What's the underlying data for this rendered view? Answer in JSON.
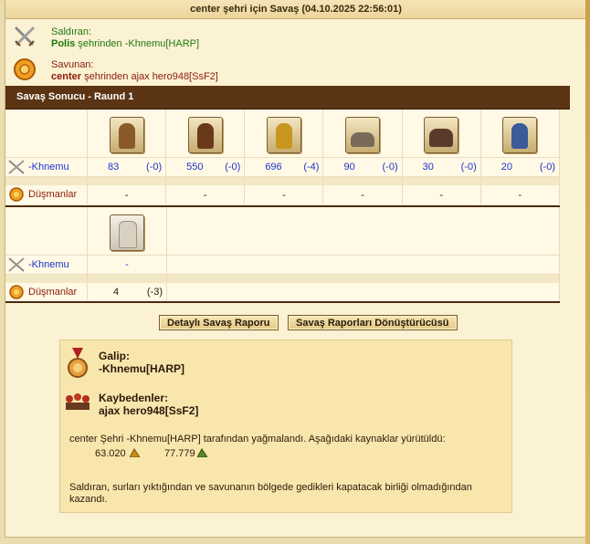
{
  "window": {
    "title": "center şehri için Savaş (04.10.2025 22:56:01)"
  },
  "attacker": {
    "label": "Saldıran:",
    "city": "Polis",
    "from_text": " şehrinden -Khnemu[HARP]",
    "icon": "crossed-swords-icon"
  },
  "defender": {
    "label": "Savunan:",
    "city": "center",
    "from_text": " şehrinden ajax hero948[SsF2]",
    "icon": "shield-icon"
  },
  "round": {
    "title": "Savaş Sonucu - Raund 1"
  },
  "section1": {
    "attacker_label": "-Khnemu",
    "enemy_label": "Düşmanlar",
    "units": [
      {
        "icon": "swordsman-icon",
        "count": "83",
        "change": "(-0)",
        "enemy": "-"
      },
      {
        "icon": "slinger-icon",
        "count": "550",
        "change": "(-0)",
        "enemy": "-"
      },
      {
        "icon": "hoplite-icon",
        "count": "696",
        "change": "(-4)",
        "enemy": "-"
      },
      {
        "icon": "catapult-icon",
        "count": "90",
        "change": "(-0)",
        "enemy": "-"
      },
      {
        "icon": "ram-icon",
        "count": "30",
        "change": "(-0)",
        "enemy": "-"
      },
      {
        "icon": "spearman-icon",
        "count": "20",
        "change": "(-0)",
        "enemy": "-"
      }
    ]
  },
  "section2": {
    "attacker_label": "-Khnemu",
    "enemy_label": "Düşmanlar",
    "unit": {
      "icon": "wall-icon",
      "attacker": "-",
      "count": "4",
      "change": "(-3)"
    }
  },
  "buttons": {
    "detailed": "Detaylı Savaş Raporu",
    "converter": "Savaş Raporları Dönüştürücüsü"
  },
  "result": {
    "winner_label": "Galip:",
    "winner_name": "-Khnemu[HARP]",
    "loser_label": "Kaybedenler:",
    "loser_name": "ajax hero948[SsF2]",
    "loot_text": "center Şehri -Khnemu[HARP] tarafından yağmalandı. Aşağıdaki kaynaklar yürütüldü:",
    "resource1": "63.020",
    "resource2": "77.779",
    "note": "Saldıran, surları yıktığından ve savunanın bölgede gedikleri kapatacak birliği olmadığından kazandı."
  }
}
